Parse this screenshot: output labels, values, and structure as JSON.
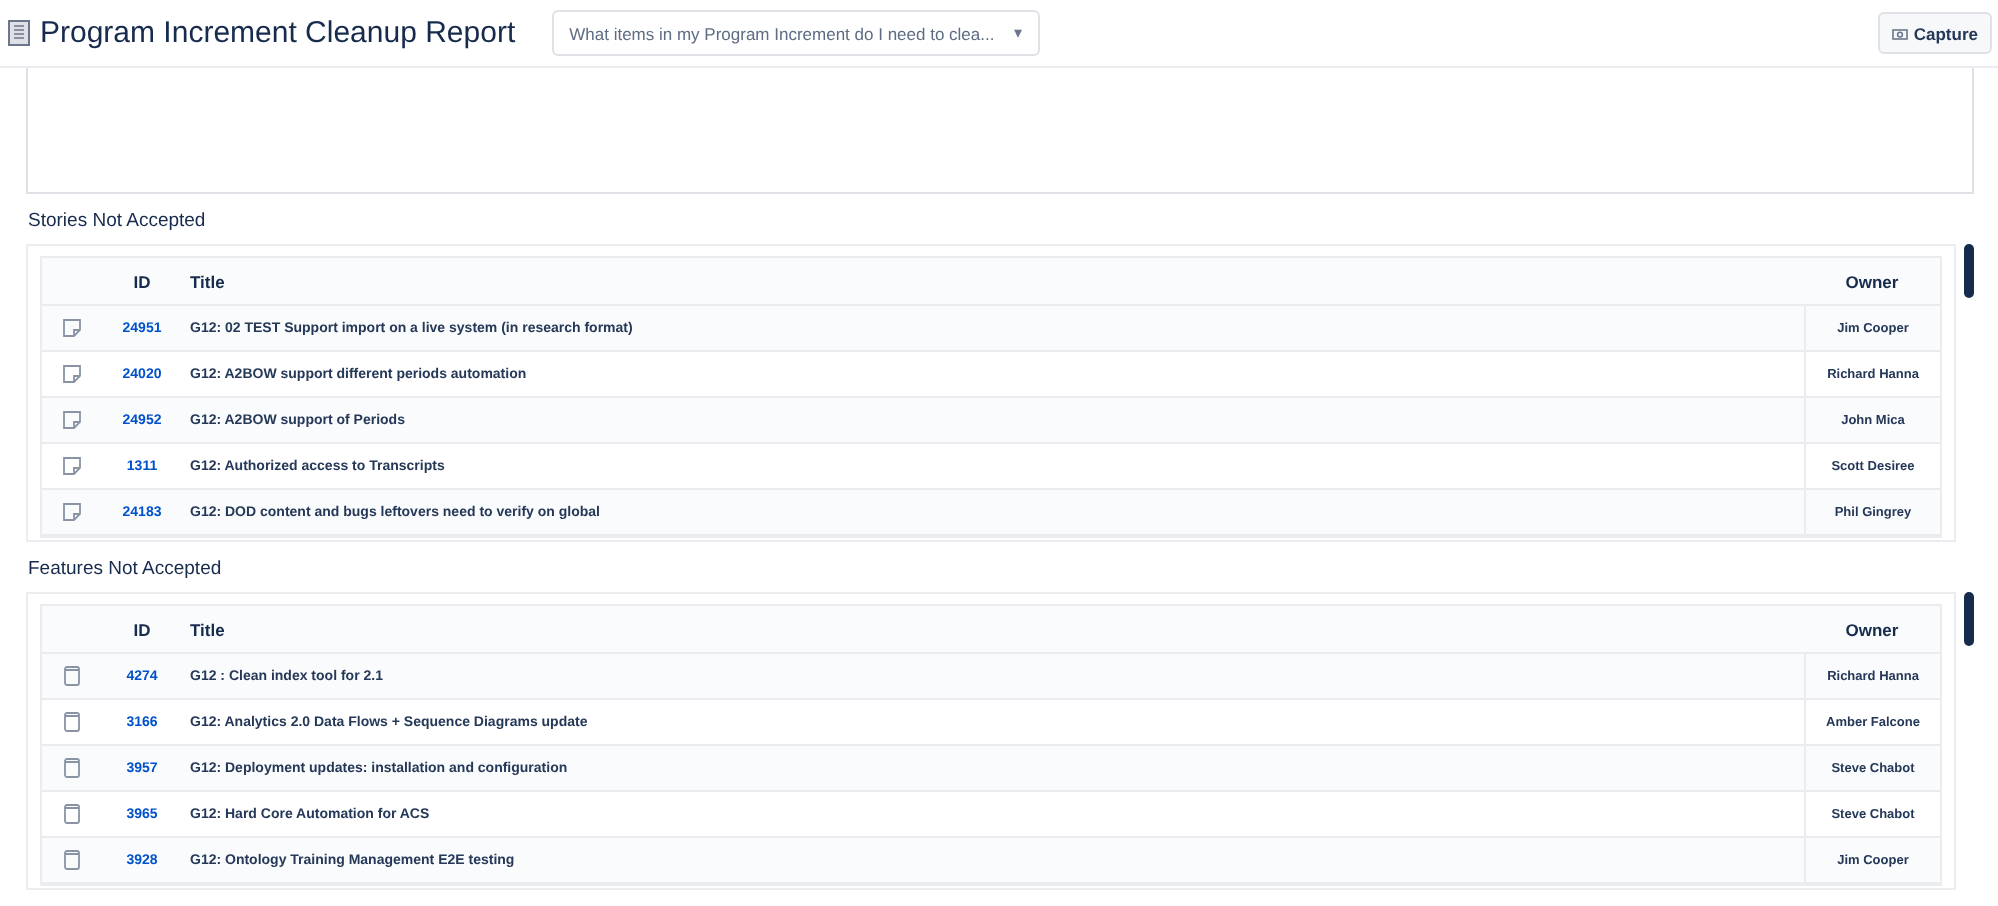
{
  "header": {
    "title": "Program Increment Cleanup Report",
    "question_dropdown": {
      "value": "What items in my Program Increment do I need to clea...",
      "caret": "▾"
    },
    "capture_button": {
      "label": "Capture"
    }
  },
  "sections": [
    {
      "title": "Stories Not Accepted",
      "kind": "story",
      "columns": [
        "ID",
        "Title",
        "Owner"
      ],
      "rows": [
        {
          "id": "24951",
          "title": "G12: 02 TEST Support import on a live system (in research format)",
          "owner": "Jim Cooper"
        },
        {
          "id": "24020",
          "title": "G12: A2BOW support different periods automation",
          "owner": "Richard Hanna"
        },
        {
          "id": "24952",
          "title": "G12: A2BOW support of Periods",
          "owner": "John Mica"
        },
        {
          "id": "1311",
          "title": "G12: Authorized access to Transcripts",
          "owner": "Scott Desiree"
        },
        {
          "id": "24183",
          "title": "G12: DOD content and bugs leftovers need to verify on global",
          "owner": "Phil Gingrey"
        }
      ]
    },
    {
      "title": "Features Not Accepted",
      "kind": "feature",
      "columns": [
        "ID",
        "Title",
        "Owner"
      ],
      "rows": [
        {
          "id": "4274",
          "title": "G12 : Clean index tool for 2.1",
          "owner": "Richard Hanna"
        },
        {
          "id": "3166",
          "title": "G12: Analytics 2.0 Data Flows + Sequence Diagrams update",
          "owner": "Amber Falcone"
        },
        {
          "id": "3957",
          "title": "G12: Deployment updates: installation and configuration",
          "owner": "Steve Chabot"
        },
        {
          "id": "3965",
          "title": "G12: Hard Core Automation for ACS",
          "owner": "Steve Chabot"
        },
        {
          "id": "3928",
          "title": "G12: Ontology Training Management E2E testing",
          "owner": "Jim Cooper"
        }
      ]
    }
  ]
}
